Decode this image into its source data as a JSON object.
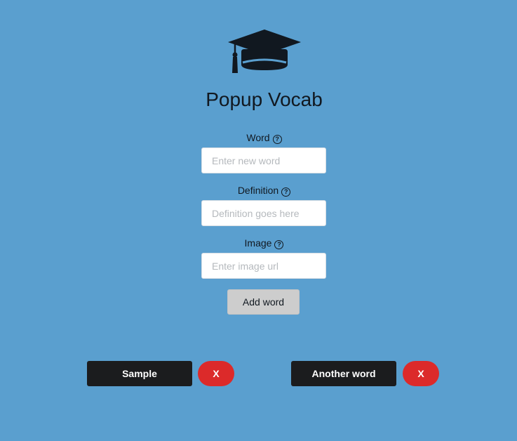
{
  "app": {
    "title": "Popup Vocab",
    "logo_icon": "graduation-cap-icon",
    "background_color": "#5a9fcf"
  },
  "form": {
    "word": {
      "label": "Word",
      "placeholder": "Enter new word",
      "value": "",
      "help_icon": "question-circle-icon"
    },
    "definition": {
      "label": "Definition",
      "placeholder": "Definition goes here",
      "value": "",
      "help_icon": "question-circle-icon"
    },
    "image": {
      "label": "Image",
      "placeholder": "Enter image url",
      "value": "",
      "help_icon": "question-circle-icon"
    },
    "add_button_label": "Add word"
  },
  "word_list": {
    "delete_label": "X",
    "chip_color": "#1b1c1e",
    "delete_color": "#dc2a2a",
    "items": [
      {
        "word": "Sample"
      },
      {
        "word": "Another word"
      }
    ]
  }
}
